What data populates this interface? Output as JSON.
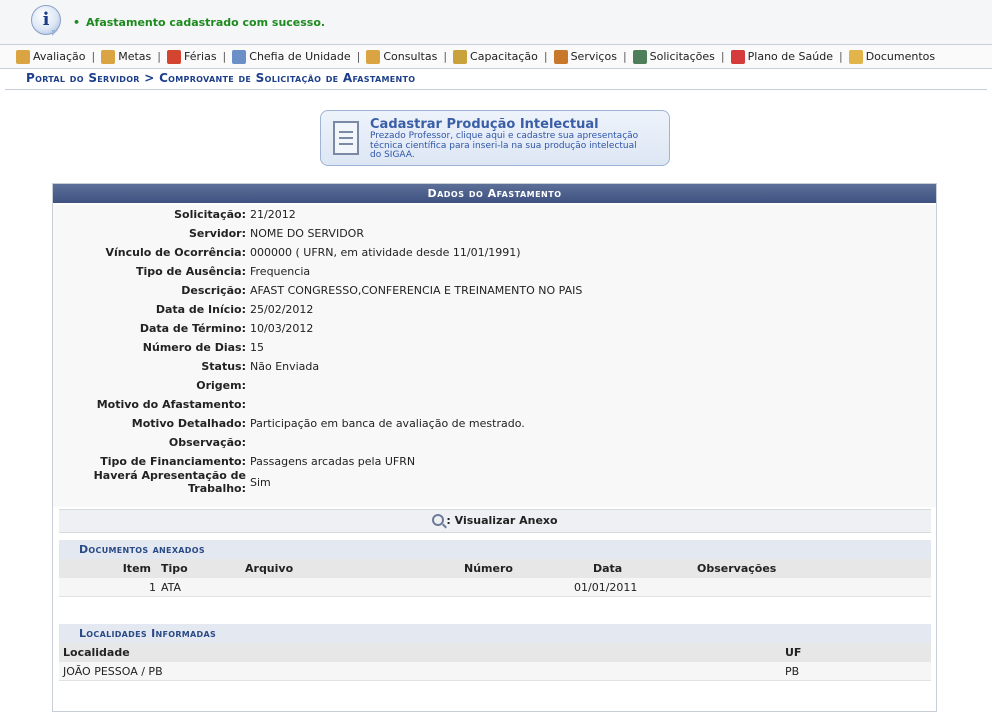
{
  "message": {
    "text": "Afastamento cadastrado com sucesso."
  },
  "menu": [
    {
      "label": "Avaliação",
      "icon": "evaluation-icon",
      "color": "#d9a441"
    },
    {
      "label": "Metas",
      "icon": "goals-icon",
      "color": "#d9a441"
    },
    {
      "label": "Férias",
      "icon": "lifebuoy-icon",
      "color": "#d4452f"
    },
    {
      "label": "Chefia de Unidade",
      "icon": "org-chart-icon",
      "color": "#6b8fc7"
    },
    {
      "label": "Consultas",
      "icon": "search-icon",
      "color": "#d9a441"
    },
    {
      "label": "Capacitação",
      "icon": "training-icon",
      "color": "#c9a23b"
    },
    {
      "label": "Serviços",
      "icon": "person-icon",
      "color": "#c7782a"
    },
    {
      "label": "Solicitações",
      "icon": "calculator-icon",
      "color": "#4f7e5a"
    },
    {
      "label": "Plano de Saúde",
      "icon": "health-cross-icon",
      "color": "#d63b3b"
    },
    {
      "label": "Documentos",
      "icon": "folder-icon",
      "color": "#e2b54a"
    }
  ],
  "breadcrumb": "Portal do Servidor > Comprovante de Solicitação de Afastamento",
  "banner": {
    "title": "Cadastrar Produção Intelectual",
    "text": "Prezado Professor, clique aqui e cadastre sua apresentação técnica científica para inseri-la na sua produção intelectual do SIGAA."
  },
  "panel": {
    "title": "Dados do Afastamento",
    "fields": [
      {
        "label": "Solicitação:",
        "value": "21/2012"
      },
      {
        "label": "Servidor:",
        "value": "NOME DO SERVIDOR"
      },
      {
        "label": "Vínculo de Ocorrência:",
        "value": "000000 ( UFRN, em atividade desde 11/01/1991)"
      },
      {
        "label": "Tipo de Ausência:",
        "value": "Frequencia"
      },
      {
        "label": "Descrição:",
        "value": "AFAST CONGRESSO,CONFERENCIA E TREINAMENTO NO PAIS"
      },
      {
        "label": "Data de Início:",
        "value": "25/02/2012"
      },
      {
        "label": "Data de Término:",
        "value": "10/03/2012"
      },
      {
        "label": "Número de Dias:",
        "value": "15"
      },
      {
        "label": "Status:",
        "value": "Não Enviada"
      },
      {
        "label": "Origem:",
        "value": ""
      },
      {
        "label": "Motivo do Afastamento:",
        "value": ""
      },
      {
        "label": "Motivo Detalhado:",
        "value": "Participação em banca de avaliação de mestrado."
      },
      {
        "label": "Observação:",
        "value": ""
      },
      {
        "label": "Tipo de Financiamento:",
        "value": "Passagens arcadas pela UFRN"
      },
      {
        "label": "Haverá Apresentação de Trabalho:",
        "value": "Sim"
      }
    ],
    "anexo_label": ": Visualizar Anexo",
    "documents": {
      "title": "Documentos anexados",
      "columns": [
        "Item",
        "Tipo",
        "Arquivo",
        "Número",
        "Data",
        "Observações"
      ],
      "rows": [
        [
          "1",
          "ATA",
          "",
          "",
          "01/01/2011",
          ""
        ]
      ]
    },
    "localities": {
      "title": "Localidades Informadas",
      "columns": [
        "Localidade",
        "UF"
      ],
      "rows": [
        [
          "JOÃO PESSOA / PB",
          "PB"
        ]
      ]
    }
  }
}
